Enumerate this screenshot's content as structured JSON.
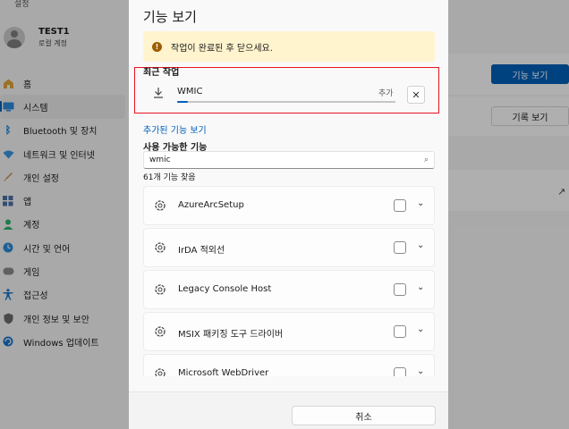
{
  "settings": {
    "app_title": "설정",
    "user": {
      "name": "TEST1",
      "subtitle": "로컬 계정"
    },
    "nav": [
      {
        "label": "홈",
        "icon": "home-icon"
      },
      {
        "label": "시스템",
        "icon": "system-icon",
        "active": true
      },
      {
        "label": "Bluetooth 및 장치",
        "icon": "bluetooth-icon"
      },
      {
        "label": "네트워크 및 인터넷",
        "icon": "network-icon"
      },
      {
        "label": "개인 설정",
        "icon": "personalization-icon"
      },
      {
        "label": "앱",
        "icon": "apps-icon"
      },
      {
        "label": "계정",
        "icon": "account-icon"
      },
      {
        "label": "시간 및 언어",
        "icon": "time-language-icon"
      },
      {
        "label": "게임",
        "icon": "gaming-icon"
      },
      {
        "label": "접근성",
        "icon": "accessibility-icon"
      },
      {
        "label": "개인 정보 및 보안",
        "icon": "privacy-icon"
      },
      {
        "label": "Windows 업데이트",
        "icon": "windows-update-icon"
      }
    ],
    "view_features_label": "기능 보기",
    "view_history_label": "기록 보기"
  },
  "dialog": {
    "title": "기능 보기",
    "info_message": "작업이 완료된 후 닫으세요.",
    "recent_section": "최근 작업",
    "recent_item": {
      "name": "WMIC",
      "status": "추가",
      "progress": 0.05
    },
    "added_link": "추가된 기능 보기",
    "available_section": "사용 가능한 기능",
    "search": {
      "value": "wmic",
      "placeholder": ""
    },
    "result_count": "61개 기능 찾음",
    "features": [
      {
        "label": "AzureArcSetup"
      },
      {
        "label": "IrDA 적외선"
      },
      {
        "label": "Legacy Console Host"
      },
      {
        "label": "MSIX 패키징 도구 드라이버"
      },
      {
        "label": "Microsoft WebDriver"
      }
    ],
    "cancel_label": "취소"
  },
  "colors": {
    "accent": "#005fb8",
    "warning_bg": "#fff4ce",
    "highlight_border": "#e81123"
  }
}
